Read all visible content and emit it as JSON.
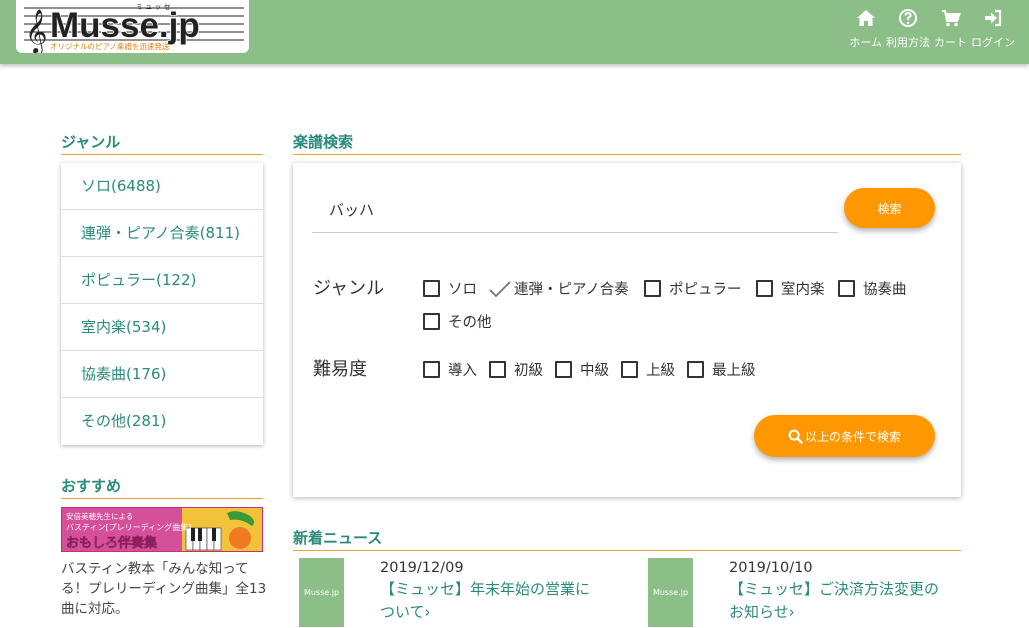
{
  "header": {
    "logo": {
      "brand": "Musse.jp",
      "kana": "ミ ュ ッ セ",
      "tagline": "オリジナルのピアノ楽譜を迅速発送"
    },
    "nav": [
      {
        "label": "ホーム",
        "icon": "home-icon"
      },
      {
        "label": "利用方法",
        "icon": "question-circle-icon"
      },
      {
        "label": "カート",
        "icon": "cart-icon"
      },
      {
        "label": "ログイン",
        "icon": "login-icon"
      }
    ],
    "colors": {
      "bar": "#8cbf88",
      "accent": "#ff9800",
      "link": "#2a8a7c"
    }
  },
  "sidebar": {
    "genre_title": "ジャンル",
    "genres": [
      {
        "label": "ソロ(6488)"
      },
      {
        "label": "連弾・ピアノ合奏(811)"
      },
      {
        "label": "ポピュラー(122)"
      },
      {
        "label": "室内楽(534)"
      },
      {
        "label": "協奏曲(176)"
      },
      {
        "label": "その他(281)"
      }
    ],
    "recommend_title": "おすすめ",
    "banner": {
      "line1": "安倍美穂先生による",
      "line2": "バスティン[プレリーディング曲集]",
      "line3": "おもしろ伴奏集"
    },
    "recommend_desc": "バスティン教本「みんな知ってる！プレリーディング曲集」全13曲に対応。"
  },
  "search": {
    "title": "楽譜検索",
    "query": "バッハ",
    "search_button": "検索",
    "genre_label": "ジャンル",
    "genre_options": [
      {
        "label": "ソロ",
        "checked": false
      },
      {
        "label": "連弾・ピアノ合奏",
        "checked": true
      },
      {
        "label": "ポピュラー",
        "checked": false
      },
      {
        "label": "室内楽",
        "checked": false
      },
      {
        "label": "協奏曲",
        "checked": false
      },
      {
        "label": "その他",
        "checked": false
      }
    ],
    "level_label": "難易度",
    "level_options": [
      {
        "label": "導入",
        "checked": false
      },
      {
        "label": "初級",
        "checked": false
      },
      {
        "label": "中級",
        "checked": false
      },
      {
        "label": "上級",
        "checked": false
      },
      {
        "label": "最上級",
        "checked": false
      }
    ],
    "condition_button": "以上の条件で検索"
  },
  "news": {
    "title": "新着ニュース",
    "items": [
      {
        "thumb": "Musse.jp",
        "date": "2019/12/09",
        "title_line1": "【ミュッセ】年末年始の営業に",
        "title_line2": "ついて›"
      },
      {
        "thumb": "Musse.jp",
        "date": "2019/10/10",
        "title_line1": "【ミュッセ】ご決済方法変更の",
        "title_line2": "お知らせ›"
      }
    ]
  }
}
